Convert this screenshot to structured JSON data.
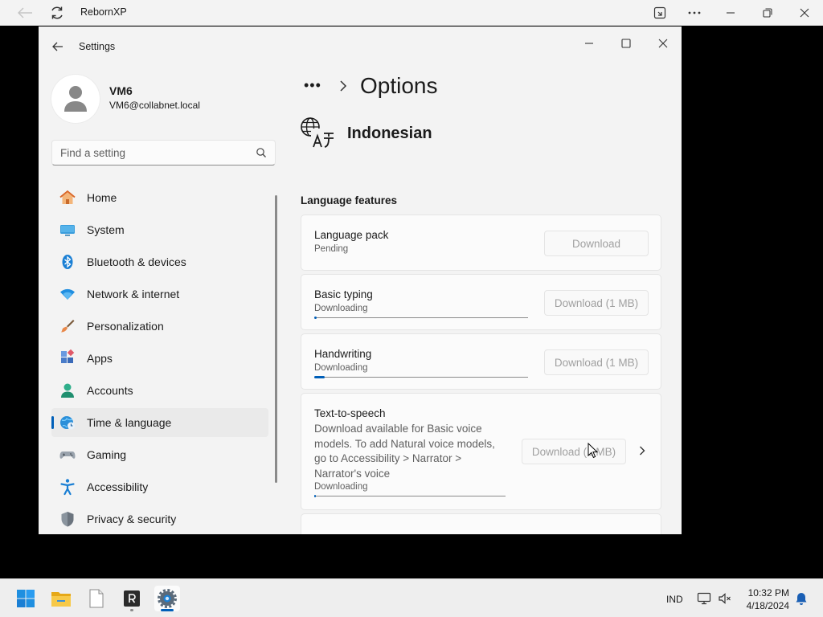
{
  "host": {
    "title": "RebornXP",
    "icons": [
      "back-arrow-icon",
      "refresh-icon",
      "cast-icon",
      "more-icon",
      "minimize-icon",
      "restore-icon",
      "close-icon"
    ]
  },
  "window": {
    "title": "Settings"
  },
  "profile": {
    "name": "VM6",
    "email": "VM6@collabnet.local"
  },
  "search": {
    "placeholder": "Find a setting"
  },
  "sidebar": {
    "items": [
      {
        "label": "Home",
        "icon": "home-icon"
      },
      {
        "label": "System",
        "icon": "system-icon"
      },
      {
        "label": "Bluetooth & devices",
        "icon": "bluetooth-icon"
      },
      {
        "label": "Network & internet",
        "icon": "wifi-icon"
      },
      {
        "label": "Personalization",
        "icon": "brush-icon"
      },
      {
        "label": "Apps",
        "icon": "apps-icon"
      },
      {
        "label": "Accounts",
        "icon": "account-icon"
      },
      {
        "label": "Time & language",
        "icon": "globe-clock-icon",
        "active": true
      },
      {
        "label": "Gaming",
        "icon": "gamepad-icon"
      },
      {
        "label": "Accessibility",
        "icon": "accessibility-icon"
      },
      {
        "label": "Privacy & security",
        "icon": "shield-icon"
      }
    ]
  },
  "main": {
    "breadcrumb_overflow": "•••",
    "title": "Options",
    "language": "Indonesian",
    "section_title": "Language features",
    "features": [
      {
        "title": "Language pack",
        "status": "Pending",
        "button": "Download"
      },
      {
        "title": "Basic typing",
        "status": "Downloading",
        "button": "Download (1 MB)",
        "progress": 0.01
      },
      {
        "title": "Handwriting",
        "status": "Downloading",
        "button": "Download (1 MB)",
        "progress": 0.05
      },
      {
        "title": "Text-to-speech",
        "description": "Download available for Basic voice models. To add Natural voice models, go to Accessibility > Narrator > Narrator's voice",
        "status": "Downloading",
        "button": "Download (1 MB)",
        "progress": 0.01
      }
    ]
  },
  "taskbar": {
    "apps": [
      "windows-start-icon",
      "file-explorer-icon",
      "notepad-icon",
      "rebornxp-icon",
      "settings-icon"
    ],
    "language": "IND",
    "time": "10:32 PM",
    "date": "4/18/2024"
  },
  "colors": {
    "accent": "#005fb8",
    "window_bg": "#f3f3f3",
    "card_bg": "#fbfbfb"
  }
}
